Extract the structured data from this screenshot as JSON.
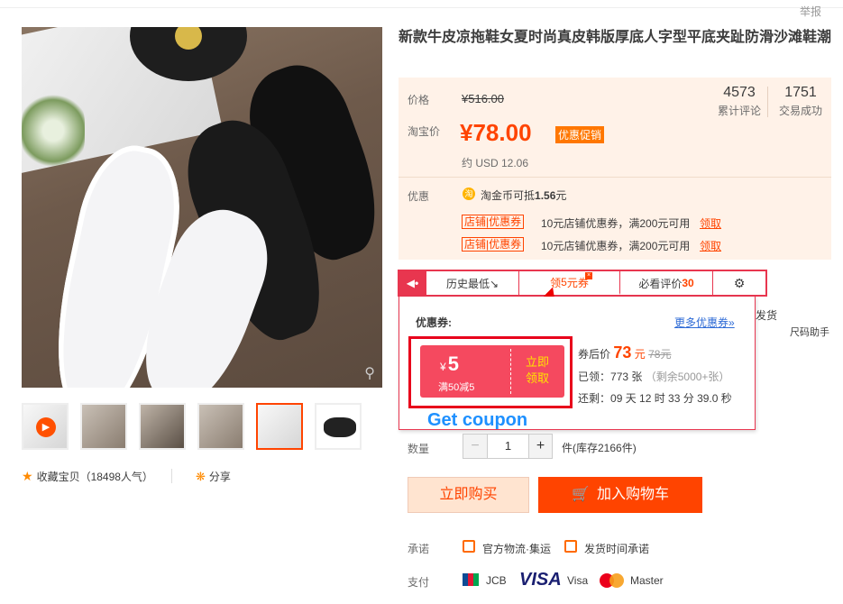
{
  "report": "举报",
  "title": "新款牛皮凉拖鞋女夏时尚真皮韩版厚底人字型平底夹趾防滑沙滩鞋潮",
  "price": {
    "label_price": "价格",
    "original": "¥516.00",
    "label_taobao": "淘宝价",
    "current": "¥78.00",
    "promo_tag": "优惠促销",
    "usd": "约 USD 12.06",
    "reviews_count": "4573",
    "reviews_label": "累计评论",
    "sales_count": "1751",
    "sales_label": "交易成功"
  },
  "promo": {
    "label": "优惠",
    "coin_icon": "淘",
    "coin_text_prefix": "淘金币可抵",
    "coin_amount": "1.56",
    "coin_text_suffix": "元",
    "coupons": [
      {
        "tag": "店铺|优惠券",
        "text": "10元店铺优惠券，满200元可用",
        "link": "领取"
      },
      {
        "tag": "店铺|优惠券",
        "text": "10元店铺优惠券，满200元可用",
        "link": "领取"
      }
    ]
  },
  "tool_tabs": {
    "history_low": "历史最低↘",
    "coupon_prefix": "领",
    "coupon_amount": "5",
    "coupon_suffix": "元券",
    "must_see_prefix": "必看评价",
    "must_see_count": "30"
  },
  "behind_tail": "发货",
  "size_help": "尺码助手",
  "coupon_panel": {
    "title": "优惠券:",
    "more": "更多优惠券»",
    "currency": "¥",
    "amount": "5",
    "condition": "满50减5",
    "claim_line1": "立即",
    "claim_line2": "领取",
    "after_label": "券后价",
    "after_price": "73",
    "after_unit": "元",
    "before_price": "78元",
    "claimed_label": "已领：",
    "claimed_value": "773 张",
    "remaining": "（剩余5000+张）",
    "countdown_label": "还剩：",
    "countdown": "09 天 12 时 33 分 39.0 秒"
  },
  "annotation": "Get coupon",
  "quantity": {
    "label": "数量",
    "minus": "−",
    "value": "1",
    "plus": "+",
    "stock": "件(库存2166件)"
  },
  "buttons": {
    "buy_now": "立即购买",
    "add_cart": "加入购物车"
  },
  "service": {
    "label": "承诺",
    "item1": "官方物流·集运",
    "item2": "发货时间承诺"
  },
  "payment": {
    "label": "支付",
    "jcb": "JCB",
    "visa_logo": "VISA",
    "visa": "Visa",
    "master": "Master"
  },
  "favorites": {
    "text": "收藏宝贝（18498人气）",
    "share": "分享"
  },
  "colors": {
    "accent": "#ff4400",
    "tool_red": "#e8364f",
    "price_bg": "#fff2e8",
    "annotation_blue": "#1e90ff"
  }
}
